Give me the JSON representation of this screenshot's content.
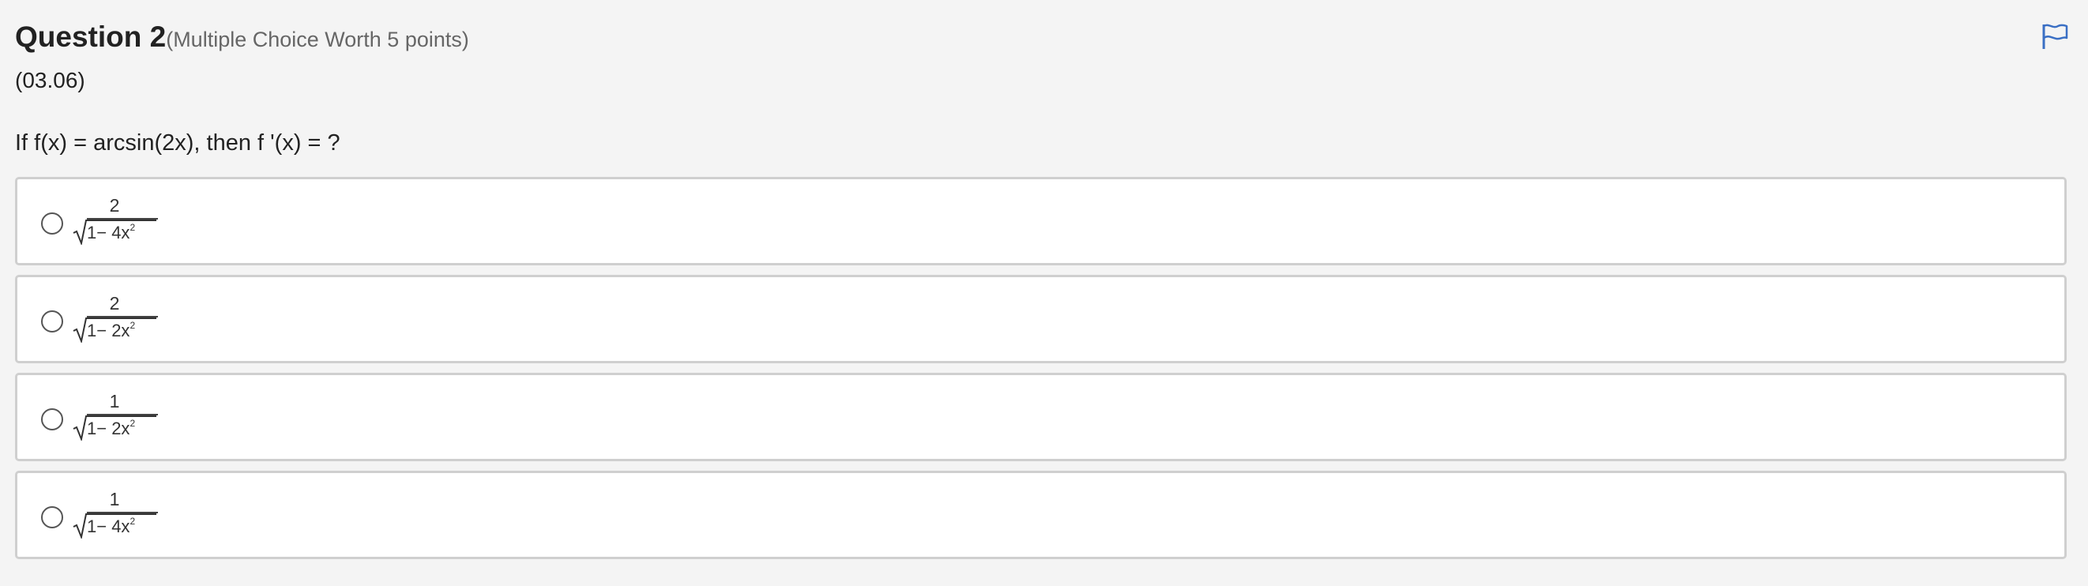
{
  "question": {
    "title": "Question 2",
    "worth": "(Multiple Choice Worth 5 points)",
    "section": "(03.06)",
    "prompt": "If f(x) = arcsin(2x), then f '(x) = ?"
  },
  "flag": {
    "icon": "flag-icon",
    "color": "#3a6fc4"
  },
  "options": [
    {
      "numerator": "2",
      "denominator": "1− 4x",
      "exponent": "2"
    },
    {
      "numerator": "2",
      "denominator": "1− 2x",
      "exponent": "2"
    },
    {
      "numerator": "1",
      "denominator": "1− 2x",
      "exponent": "2"
    },
    {
      "numerator": "1",
      "denominator": "1− 4x",
      "exponent": "2"
    }
  ]
}
